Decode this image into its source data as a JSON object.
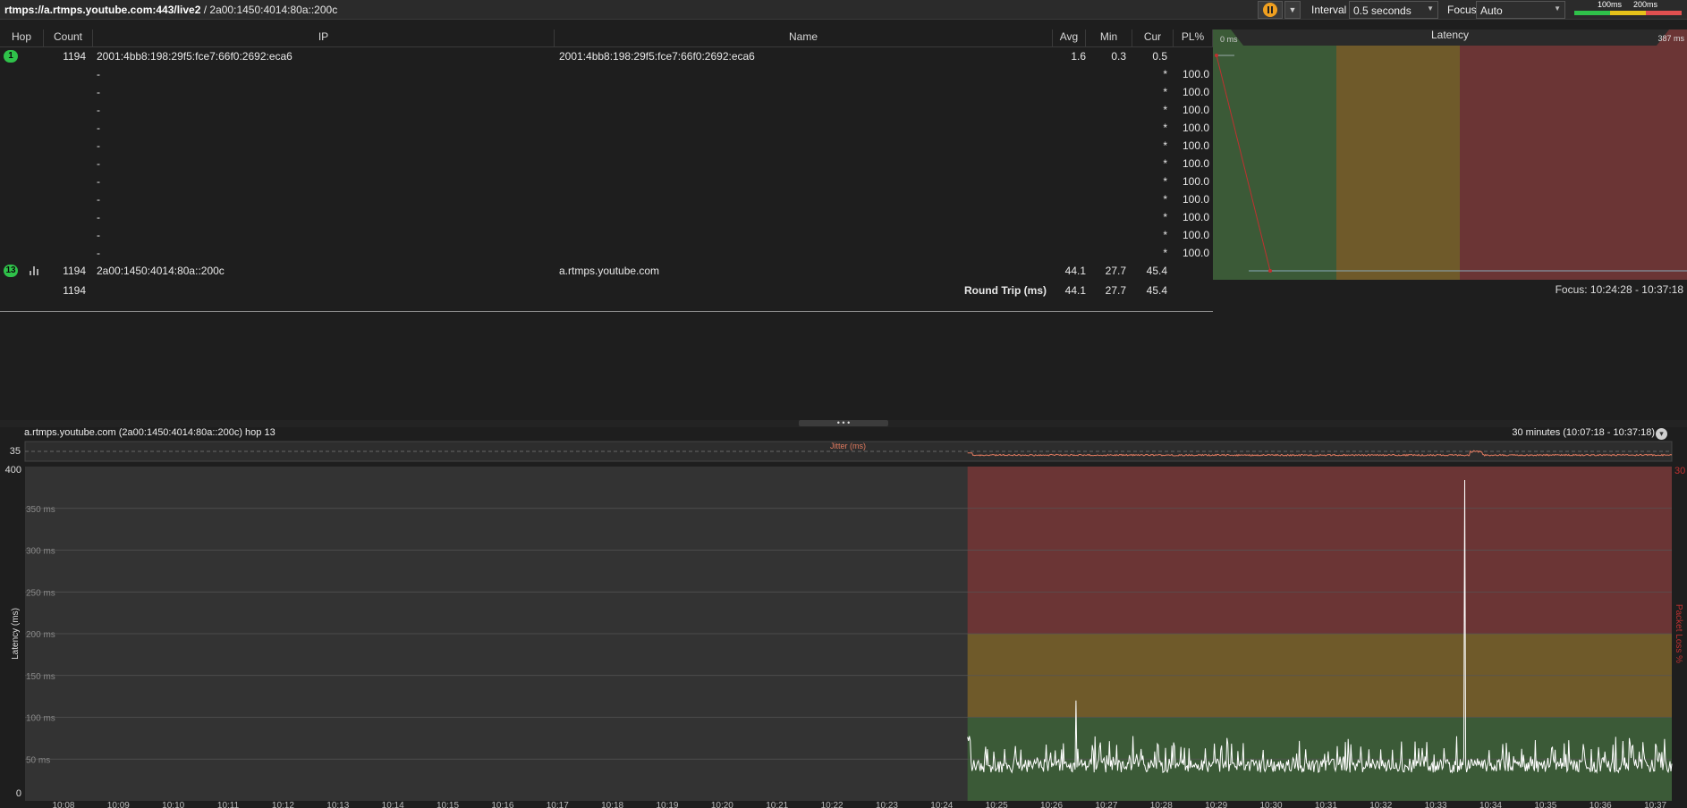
{
  "window": {
    "target_bold": "rtmps://a.rtmps.youtube.com:443/live2",
    "target_rest": " / 2a00:1450:4014:80a::200c"
  },
  "toolbar": {
    "interval_label": "Interval",
    "interval_value": "0.5 seconds",
    "focus_label": "Focus",
    "focus_value": "Auto",
    "legend_100": "100ms",
    "legend_200": "200ms",
    "colors": {
      "green": "#2fc24a",
      "yellow": "#e6c21a",
      "red": "#e05050"
    }
  },
  "table": {
    "headers": {
      "hop": "Hop",
      "count": "Count",
      "ip": "IP",
      "name": "Name",
      "avg": "Avg",
      "min": "Min",
      "cur": "Cur",
      "pl": "PL%"
    },
    "rows": [
      {
        "hop": "1",
        "count": "1194",
        "ip": "2001:4bb8:198:29f5:fce7:66f0:2692:eca6",
        "name": "2001:4bb8:198:29f5:fce7:66f0:2692:eca6",
        "avg": "1.6",
        "min": "0.3",
        "cur": "0.5",
        "pl": ""
      },
      {
        "hop": "",
        "count": "",
        "ip": "-",
        "name": "",
        "avg": "",
        "min": "",
        "cur": "*",
        "pl": "100.0"
      },
      {
        "hop": "",
        "count": "",
        "ip": "-",
        "name": "",
        "avg": "",
        "min": "",
        "cur": "*",
        "pl": "100.0"
      },
      {
        "hop": "",
        "count": "",
        "ip": "-",
        "name": "",
        "avg": "",
        "min": "",
        "cur": "*",
        "pl": "100.0"
      },
      {
        "hop": "",
        "count": "",
        "ip": "-",
        "name": "",
        "avg": "",
        "min": "",
        "cur": "*",
        "pl": "100.0"
      },
      {
        "hop": "",
        "count": "",
        "ip": "-",
        "name": "",
        "avg": "",
        "min": "",
        "cur": "*",
        "pl": "100.0"
      },
      {
        "hop": "",
        "count": "",
        "ip": "-",
        "name": "",
        "avg": "",
        "min": "",
        "cur": "*",
        "pl": "100.0"
      },
      {
        "hop": "",
        "count": "",
        "ip": "-",
        "name": "",
        "avg": "",
        "min": "",
        "cur": "*",
        "pl": "100.0"
      },
      {
        "hop": "",
        "count": "",
        "ip": "-",
        "name": "",
        "avg": "",
        "min": "",
        "cur": "*",
        "pl": "100.0"
      },
      {
        "hop": "",
        "count": "",
        "ip": "-",
        "name": "",
        "avg": "",
        "min": "",
        "cur": "*",
        "pl": "100.0"
      },
      {
        "hop": "",
        "count": "",
        "ip": "-",
        "name": "",
        "avg": "",
        "min": "",
        "cur": "*",
        "pl": "100.0"
      },
      {
        "hop": "",
        "count": "",
        "ip": "-",
        "name": "",
        "avg": "",
        "min": "",
        "cur": "*",
        "pl": "100.0"
      },
      {
        "hop": "13",
        "count": "1194",
        "ip": "2a00:1450:4014:80a::200c",
        "name": "a.rtmps.youtube.com",
        "avg": "44.1",
        "min": "27.7",
        "cur": "45.4",
        "pl": ""
      }
    ],
    "summary": {
      "count": "1194",
      "label": "Round Trip (ms)",
      "avg": "44.1",
      "min": "27.7",
      "cur": "45.4"
    }
  },
  "latency_panel": {
    "title": "Latency",
    "min_label": "0 ms",
    "max_label": "387 ms",
    "focus_range": "Focus: 10:24:28 - 10:37:18",
    "zone_colors": {
      "good": "#3b5a37",
      "warn": "#6f5a2a",
      "bad": "#6b3535"
    }
  },
  "graph": {
    "title": "a.rtmps.youtube.com (2a00:1450:4014:80a::200c) hop 13",
    "range": "30 minutes (10:07:18 - 10:37:18)",
    "jitter_label": "Jitter (ms)",
    "jitter_max": "35",
    "y_axis_label": "Latency (ms)",
    "y2_axis_label": "Packet Loss %",
    "y2_max": "30",
    "y_top": "400",
    "y_zero": "0",
    "y_ticks": [
      "350 ms",
      "300 ms",
      "250 ms",
      "200 ms",
      "150 ms",
      "100 ms",
      "50 ms"
    ],
    "x_ticks": [
      "10:08",
      "10:09",
      "10:10",
      "10:11",
      "10:12",
      "10:13",
      "10:14",
      "10:15",
      "10:16",
      "10:17",
      "10:18",
      "10:19",
      "10:20",
      "10:21",
      "10:22",
      "10:23",
      "10:24",
      "10:25",
      "10:26",
      "10:27",
      "10:28",
      "10:29",
      "10:30",
      "10:31",
      "10:32",
      "10:33",
      "10:34",
      "10:35",
      "10:36",
      "10:37"
    ]
  }
}
